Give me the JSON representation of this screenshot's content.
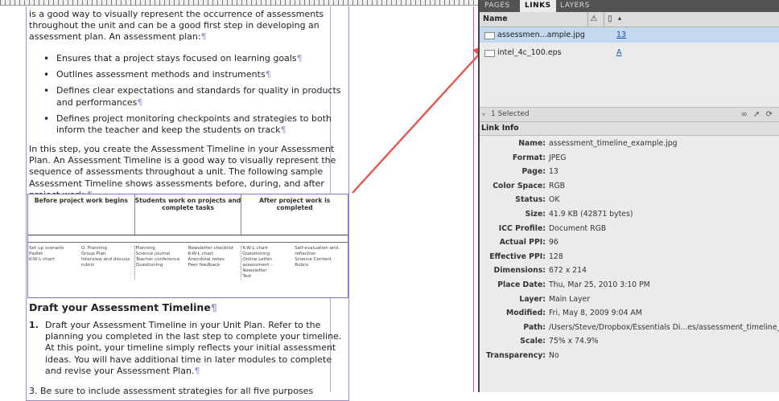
{
  "document": {
    "intro": "is a good way to visually represent the occurrence of assessments throughout the unit and can be a good first step in developing an assessment plan. An assessment plan:",
    "bullets": [
      "Ensures that a project stays focused on learning goals",
      "Outlines assessment methods and instruments",
      "Defines clear expectations and standards for quality in products and performances",
      "Defines project monitoring checkpoints and strategies to both inform the teacher and keep the students on track"
    ],
    "paragraph2": "In this step, you create the Assessment Timeline in your Assessment Plan. An Assessment Timeline is a good way to visually represent the sequence of assessments throughout a unit. The following sample Assessment Timeline shows assessments before, during, and after project work:",
    "table": {
      "headers": [
        "Before project work begins",
        "Students work on projects and complete tasks",
        "After project work is completed"
      ],
      "columns": [
        [
          [
            "Set up scenario",
            "Padlet",
            "K-W-L chart"
          ],
          [
            "Q. Planning",
            "Group Plan",
            "Interview and discuss rubric"
          ]
        ],
        [
          [
            "Planning",
            "Science journal",
            "Teacher conference",
            "Questioning"
          ],
          [
            "Newsletter checklist",
            "K-W-L chart",
            "Anecdotal notes",
            "Peer feedback"
          ]
        ],
        [
          [
            "K-W-L chart",
            "Questioning",
            "Online Letter assessment – Newsletter",
            "Test"
          ],
          [
            "Self-evaluation and reflection",
            "Science Content Rubric"
          ]
        ]
      ]
    },
    "heading": "Draft your Assessment Timeline",
    "step1_number": "1.",
    "step1": "Draft your Assessment Timeline in your Unit Plan. Refer to the planning you completed in the last step to complete your timeline. At this point, your timeline simply reflects your initial assessment ideas. You will have additional time in later modules to complete and revise your Assessment Plan.",
    "step3_partial": "3.   Be sure to include assessment strategies for all five purposes"
  },
  "panel": {
    "tabs": [
      "PAGES",
      "LINKS",
      "LAYERS"
    ],
    "active_tab": "LINKS",
    "column_header": "Name",
    "links": [
      {
        "name": "assessmen...ample.jpg",
        "page": "13",
        "selected": true
      },
      {
        "name": "intel_4c_100.eps",
        "page": "A",
        "selected": false
      }
    ],
    "status": "1 Selected",
    "link_info_title": "Link Info",
    "link_info": [
      {
        "key": "Name:",
        "value": "assessment_timeline_example.jpg"
      },
      {
        "key": "Format:",
        "value": "JPEG"
      },
      {
        "key": "Page:",
        "value": "13"
      },
      {
        "key": "Color Space:",
        "value": "RGB"
      },
      {
        "key": "Status:",
        "value": "OK"
      },
      {
        "key": "Size:",
        "value": "41.9 KB (42871 bytes)"
      },
      {
        "key": "ICC Profile:",
        "value": "Document RGB"
      },
      {
        "key": "Actual PPI:",
        "value": "96"
      },
      {
        "key": "Effective PPI:",
        "value": "128"
      },
      {
        "key": "Dimensions:",
        "value": "672 x 214"
      },
      {
        "key": "Place Date:",
        "value": "Thu, Mar 25, 2010 3:10 PM"
      },
      {
        "key": "Layer:",
        "value": "Main Layer"
      },
      {
        "key": "Modified:",
        "value": "Fri, May 8, 2009 9:04 AM"
      },
      {
        "key": "Path:",
        "value": "/Users/Steve/Dropbox/Essentials Di...es/assessment_timeline_exam"
      },
      {
        "key": "Scale:",
        "value": "75% x 74.9%"
      },
      {
        "key": "Transparency:",
        "value": "No"
      }
    ],
    "colors": {
      "arrow": "#e8544a",
      "selection": "#c4d8ee",
      "tab_bar": "#535353"
    }
  }
}
